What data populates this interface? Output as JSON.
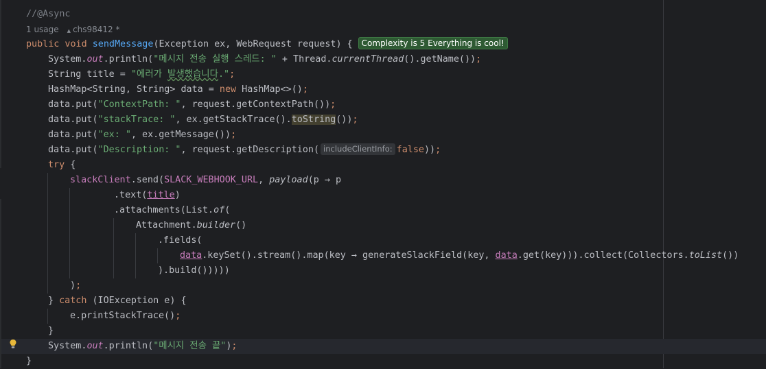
{
  "editor": {
    "lines": [
      {
        "indent": 0,
        "tokens": [
          {
            "t": "//@Async",
            "c": "cmt"
          }
        ]
      },
      {
        "type": "meta"
      },
      {
        "indent": 0,
        "tokens": [
          {
            "t": "public void ",
            "c": "kw"
          },
          {
            "t": "sendMessage",
            "c": "fn"
          },
          {
            "t": "(Exception ex, WebRequest request) {"
          }
        ],
        "badge": true
      },
      {
        "indent": 1,
        "tokens": [
          {
            "t": "System."
          },
          {
            "t": "out",
            "c": "fld"
          },
          {
            "t": ".println("
          },
          {
            "t": "\"메시지 전송 실행 스레드: \"",
            "c": "str"
          },
          {
            "t": " + Thread."
          },
          {
            "t": "currentThread",
            "c": "it"
          },
          {
            "t": "().getName())"
          },
          {
            "t": ";",
            "c": "kw"
          }
        ]
      },
      {
        "indent": 1,
        "tokens": [
          {
            "t": "String title = "
          },
          {
            "t": "\"에러가 ",
            "c": "str"
          },
          {
            "t": "발생했습니다",
            "c": "str ann-typo"
          },
          {
            "t": ".\"",
            "c": "str"
          },
          {
            "t": ";",
            "c": "kw"
          }
        ]
      },
      {
        "indent": 1,
        "tokens": [
          {
            "t": "HashMap<String, String> data = "
          },
          {
            "t": "new ",
            "c": "kw"
          },
          {
            "t": "HashMap<>()"
          },
          {
            "t": ";",
            "c": "kw"
          }
        ]
      },
      {
        "indent": 1,
        "tokens": [
          {
            "t": "data.put("
          },
          {
            "t": "\"ContextPath: \"",
            "c": "str"
          },
          {
            "t": ", request.getContextPath())"
          },
          {
            "t": ";",
            "c": "kw"
          }
        ]
      },
      {
        "indent": 1,
        "tokens": [
          {
            "t": "data.put("
          },
          {
            "t": "\"stackTrace: \"",
            "c": "str"
          },
          {
            "t": ", ex.getStackTrace()."
          },
          {
            "t": "toString",
            "c": "hl-tostring"
          },
          {
            "t": "())"
          },
          {
            "t": ";",
            "c": "kw"
          }
        ]
      },
      {
        "indent": 1,
        "tokens": [
          {
            "t": "data.put("
          },
          {
            "t": "\"ex: \"",
            "c": "str"
          },
          {
            "t": ", ex.getMessage())"
          },
          {
            "t": ";",
            "c": "kw"
          }
        ]
      },
      {
        "indent": 1,
        "tokens": [
          {
            "t": "data.put("
          },
          {
            "t": "\"Description: \"",
            "c": "str"
          },
          {
            "t": ", request.getDescription("
          },
          {
            "hint": "includeClientInfo:"
          },
          {
            "t": "false",
            "c": "kw"
          },
          {
            "t": "))"
          },
          {
            "t": ";",
            "c": "kw"
          }
        ]
      },
      {
        "indent": 1,
        "tokens": [
          {
            "t": "try ",
            "c": "kw"
          },
          {
            "t": "{"
          }
        ]
      },
      {
        "indent": 2,
        "tokens": [
          {
            "t": "slackClient",
            "c": "const"
          },
          {
            "t": ".send("
          },
          {
            "t": "SLACK_WEBHOOK_URL",
            "c": "const"
          },
          {
            "t": ", "
          },
          {
            "t": "payload",
            "c": "it"
          },
          {
            "t": "(p → p"
          }
        ]
      },
      {
        "indent": 4,
        "tokens": [
          {
            "t": ".text("
          },
          {
            "t": "title",
            "c": "var-u"
          },
          {
            "t": ")"
          }
        ]
      },
      {
        "indent": 4,
        "tokens": [
          {
            "t": ".attachments(List."
          },
          {
            "t": "of",
            "c": "it"
          },
          {
            "t": "("
          }
        ]
      },
      {
        "indent": 5,
        "tokens": [
          {
            "t": "Attachment."
          },
          {
            "t": "builder",
            "c": "it"
          },
          {
            "t": "()"
          }
        ]
      },
      {
        "indent": 6,
        "tokens": [
          {
            "t": ".fields("
          }
        ]
      },
      {
        "indent": 7,
        "tokens": [
          {
            "t": "data",
            "c": "var-u"
          },
          {
            "t": ".keySet().stream().map(key → generateSlackField(key, "
          },
          {
            "t": "data",
            "c": "var-u"
          },
          {
            "t": ".get(key))).collect(Collectors."
          },
          {
            "t": "toList",
            "c": "it"
          },
          {
            "t": "())"
          }
        ]
      },
      {
        "indent": 6,
        "tokens": [
          {
            "t": ").build()))))"
          }
        ]
      },
      {
        "indent": 2,
        "tokens": [
          {
            "t": ")"
          },
          {
            "t": ";",
            "c": "kw"
          }
        ]
      },
      {
        "indent": 1,
        "tokens": [
          {
            "t": "} "
          },
          {
            "t": "catch ",
            "c": "kw"
          },
          {
            "t": "(IOException e) {"
          }
        ]
      },
      {
        "indent": 2,
        "tokens": [
          {
            "t": "e.printStackTrace()"
          },
          {
            "t": ";",
            "c": "kw"
          }
        ]
      },
      {
        "indent": 1,
        "tokens": [
          {
            "t": "}"
          }
        ]
      },
      {
        "indent": 1,
        "current": true,
        "bulb": true,
        "tokens": [
          {
            "t": "System."
          },
          {
            "t": "out",
            "c": "fld"
          },
          {
            "t": ".println("
          },
          {
            "t": "\"메시지 전송 끝\"",
            "c": "str"
          },
          {
            "t": ")"
          },
          {
            "t": ";",
            "c": "kw"
          }
        ]
      },
      {
        "indent": 0,
        "tokens": [
          {
            "t": "}"
          }
        ]
      }
    ],
    "meta": {
      "usages": "1 usage",
      "author": "chs98412 *"
    },
    "badge": "Complexity is 5 Everything is cool!",
    "icons": {
      "author": "user-icon",
      "bulb": "lightbulb-icon"
    },
    "colors": {
      "keyword": "#cf8e6d",
      "string": "#6aab73",
      "function": "#56a8f5",
      "field": "#c77dbb",
      "background": "#1e1f22"
    }
  }
}
